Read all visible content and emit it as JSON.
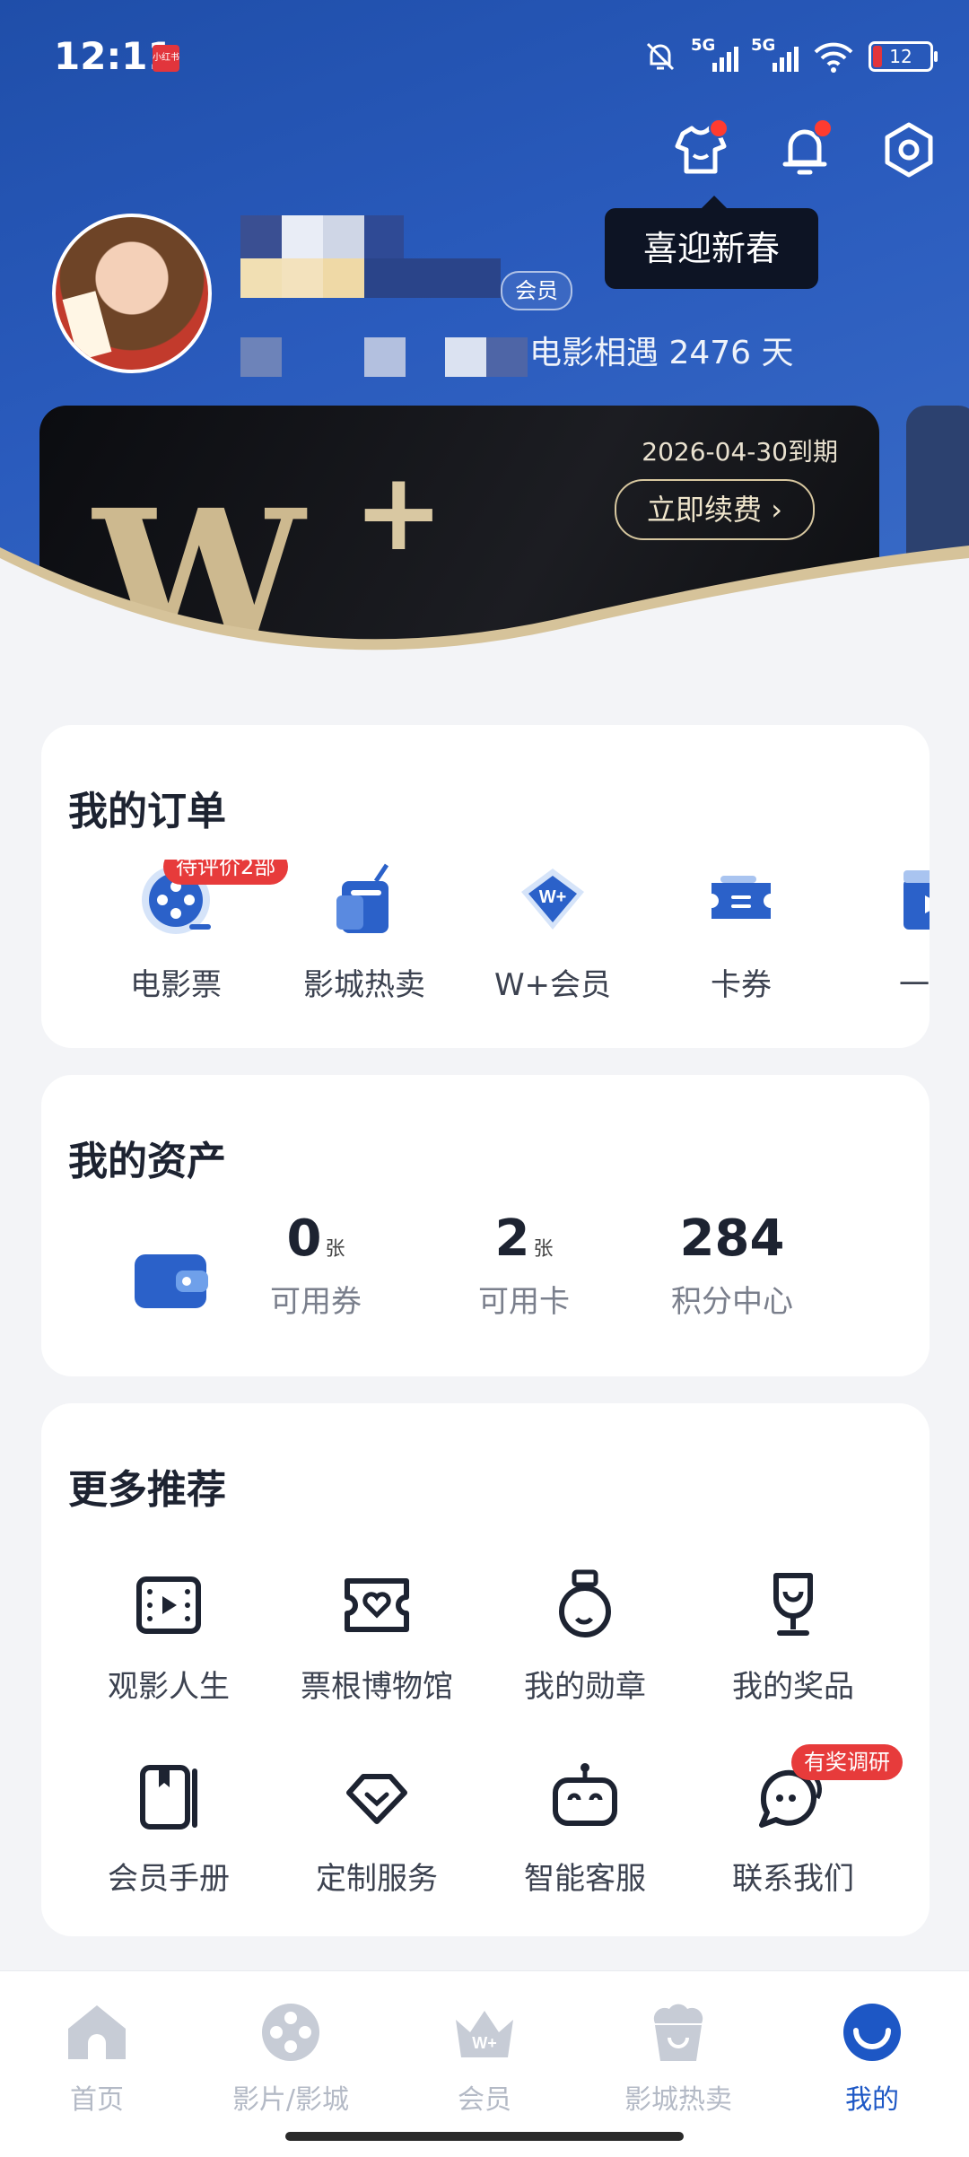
{
  "status_bar": {
    "time": "12:11",
    "app_badge": "小红书",
    "signal1": "5G",
    "signal2": "5G",
    "battery": "12"
  },
  "header": {
    "tooltip": "喜迎新春",
    "member_tag": "会员",
    "days_text": "电影相遇 2476 天"
  },
  "wplus": {
    "logo_w": "W",
    "logo_plus": "+",
    "expiry": "2026-04-30到期",
    "renew": "立即续费 ›"
  },
  "orders": {
    "title": "我的订单",
    "badge": "待评价2部",
    "items": [
      {
        "label": "电影票",
        "icon": "film-reel-icon"
      },
      {
        "label": "影城热卖",
        "icon": "popcorn-bag-icon"
      },
      {
        "label": "W+会员",
        "icon": "w-plus-diamond-icon"
      },
      {
        "label": "卡券",
        "icon": "ticket-coupon-icon"
      },
      {
        "label": "一起",
        "icon": "video-clapper-icon"
      }
    ]
  },
  "assets": {
    "title": "我的资产",
    "items": [
      {
        "num": "0",
        "unit": "张",
        "label": "可用券"
      },
      {
        "num": "2",
        "unit": "张",
        "label": "可用卡"
      },
      {
        "num": "284",
        "unit": "",
        "label": "积分中心"
      }
    ]
  },
  "more": {
    "title": "更多推荐",
    "badge": "有奖调研",
    "items": [
      {
        "label": "观影人生",
        "icon": "film-frame-icon"
      },
      {
        "label": "票根博物馆",
        "icon": "ticket-heart-icon"
      },
      {
        "label": "我的勋章",
        "icon": "medal-icon"
      },
      {
        "label": "我的奖品",
        "icon": "trophy-icon"
      },
      {
        "label": "会员手册",
        "icon": "handbook-icon"
      },
      {
        "label": "定制服务",
        "icon": "diamond-icon"
      },
      {
        "label": "智能客服",
        "icon": "robot-icon"
      },
      {
        "label": "联系我们",
        "icon": "chat-bubble-icon"
      }
    ]
  },
  "tabbar": {
    "items": [
      {
        "label": "首页",
        "icon": "home-icon"
      },
      {
        "label": "影片/影城",
        "icon": "film-reel-icon"
      },
      {
        "label": "会员",
        "icon": "crown-icon"
      },
      {
        "label": "影城热卖",
        "icon": "popcorn-icon"
      },
      {
        "label": "我的",
        "icon": "smile-profile-icon"
      }
    ],
    "active_index": 4
  },
  "colors": {
    "brand_blue": "#1d57c5",
    "hero_blue": "#2a5bbd",
    "badge_red": "#e73b3b",
    "gold": "#cdb98f"
  }
}
